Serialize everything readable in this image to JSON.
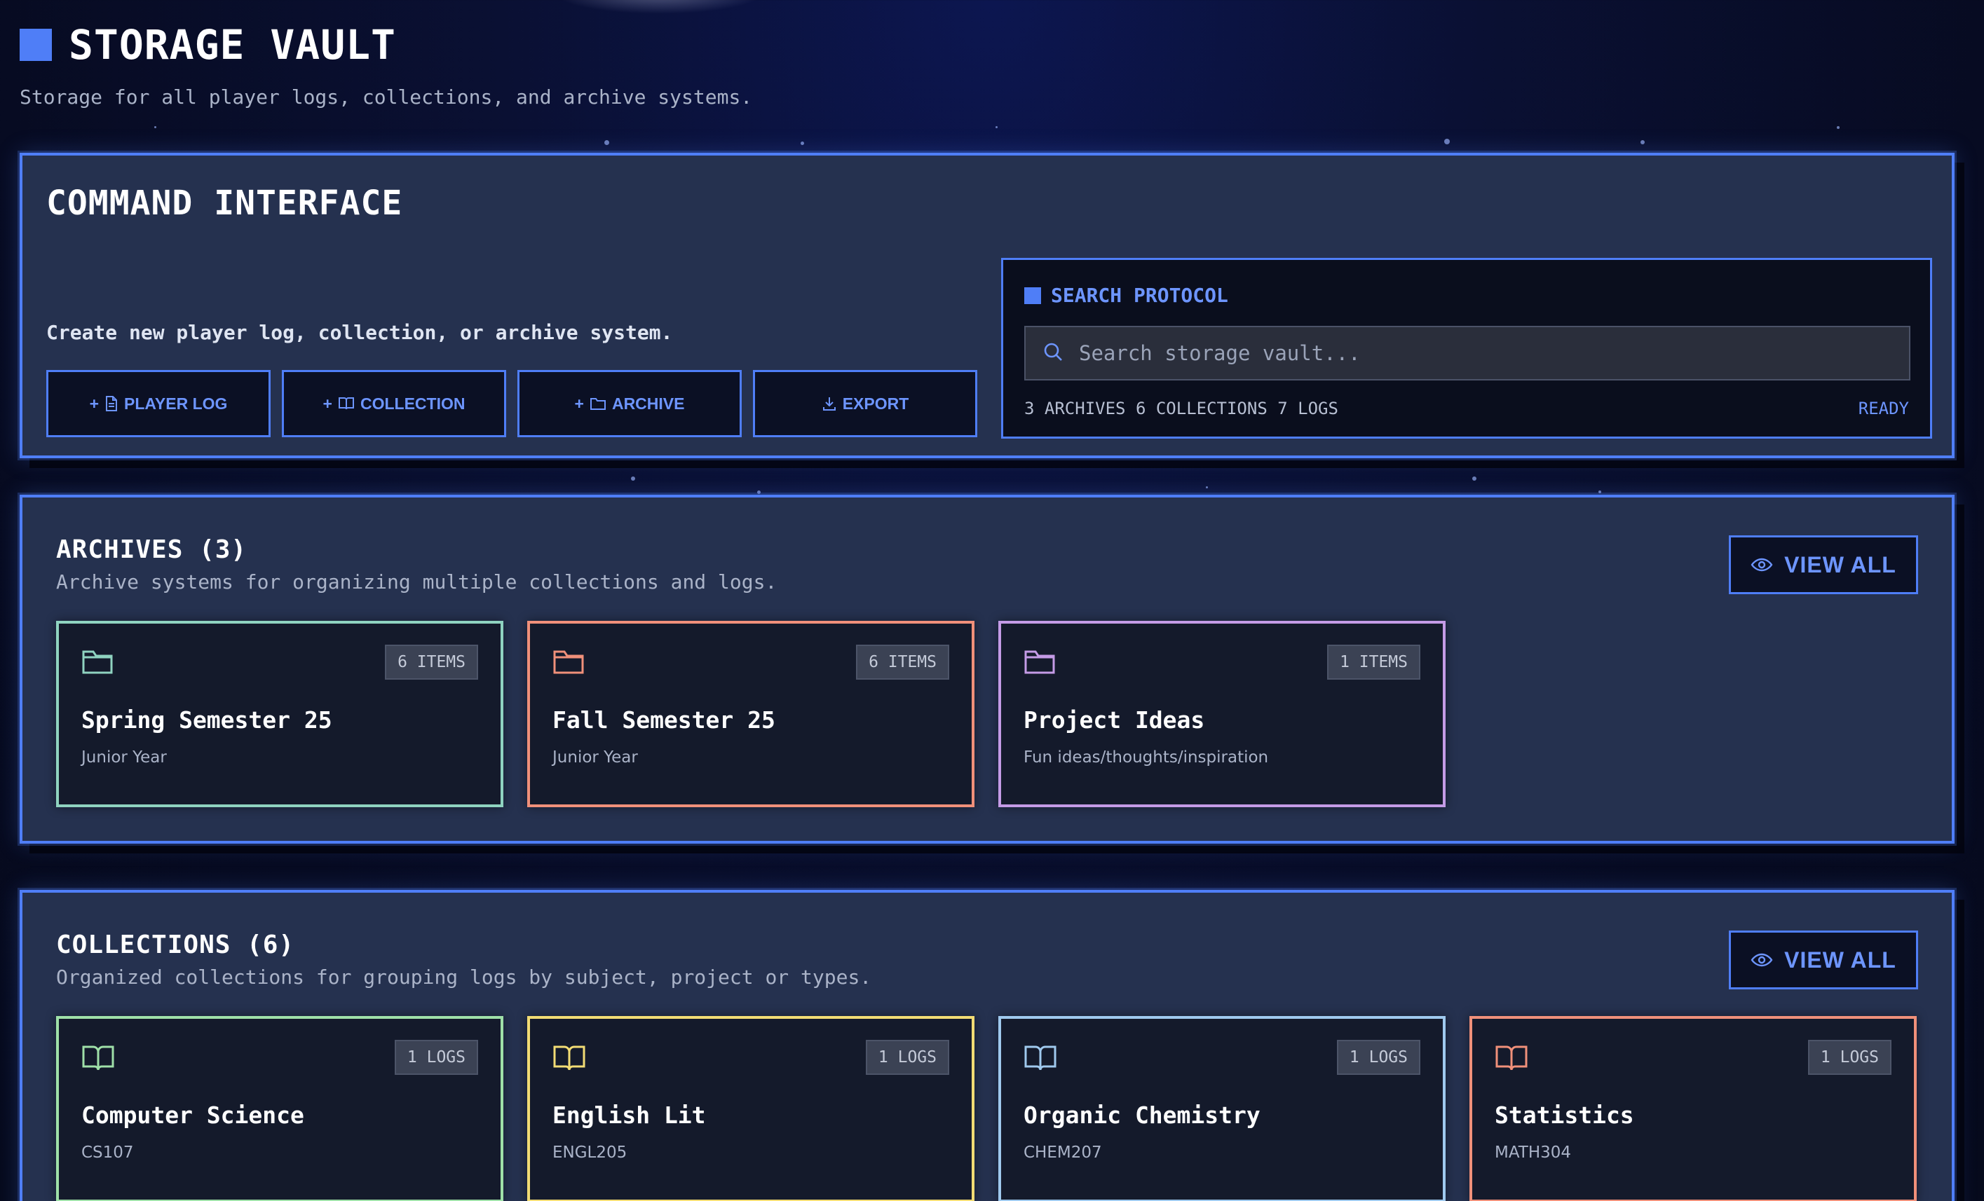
{
  "header": {
    "title": "STORAGE VAULT",
    "subtitle": "Storage for all player logs, collections, and archive systems."
  },
  "command": {
    "title": "COMMAND INTERFACE",
    "description": "Create new player log, collection, or archive system.",
    "buttons": [
      {
        "label": "PLAYER LOG",
        "icon": "file-icon"
      },
      {
        "label": "COLLECTION",
        "icon": "book-icon"
      },
      {
        "label": "ARCHIVE",
        "icon": "folder-icon"
      },
      {
        "label": "EXPORT",
        "icon": "download-icon"
      }
    ],
    "search": {
      "title": "SEARCH PROTOCOL",
      "placeholder": "Search storage vault...",
      "value": "",
      "stats": "3 ARCHIVES 6 COLLECTIONS 7 LOGS",
      "status": "READY"
    }
  },
  "archives": {
    "title": "ARCHIVES (3)",
    "subtitle": "Archive systems for organizing multiple collections and logs.",
    "view_all": "VIEW ALL",
    "items": [
      {
        "title": "Spring Semester 25",
        "subtitle": "Junior Year",
        "badge": "6 ITEMS",
        "color": "#8fd3c0"
      },
      {
        "title": "Fall Semester 25",
        "subtitle": "Junior Year",
        "badge": "6 ITEMS",
        "color": "#f0907a"
      },
      {
        "title": "Project Ideas",
        "subtitle": "Fun ideas/thoughts/inspiration",
        "badge": "1 ITEMS",
        "color": "#c49be6"
      }
    ]
  },
  "collections": {
    "title": "COLLECTIONS (6)",
    "subtitle": "Organized collections for grouping logs by subject, project or types.",
    "view_all": "VIEW ALL",
    "items": [
      {
        "title": "Computer Science",
        "subtitle": "CS107",
        "badge": "1 LOGS",
        "color": "#9fe0a8"
      },
      {
        "title": "English Lit",
        "subtitle": "ENGL205",
        "badge": "1 LOGS",
        "color": "#f2dc74"
      },
      {
        "title": "Organic Chemistry",
        "subtitle": "CHEM207",
        "badge": "1 LOGS",
        "color": "#9fc9ee"
      },
      {
        "title": "Statistics",
        "subtitle": "MATH304",
        "badge": "1 LOGS",
        "color": "#f0907a"
      }
    ]
  },
  "colors": {
    "accent": "#4f7ef7",
    "accent_text": "#6d95ff",
    "panel": "#25314f",
    "card": "#141a2b"
  }
}
